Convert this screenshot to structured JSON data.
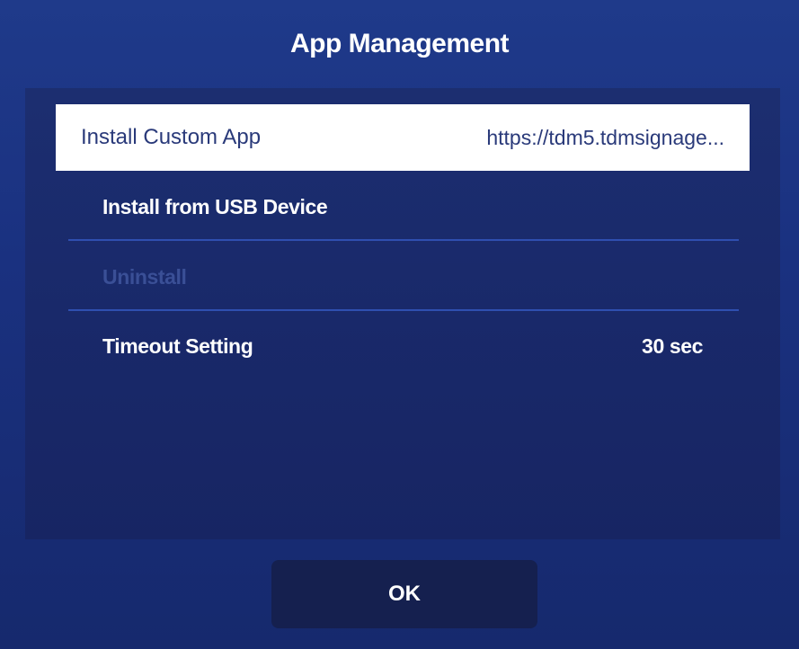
{
  "dialog": {
    "title": "App Management",
    "ok_label": "OK"
  },
  "menu": {
    "items": [
      {
        "label": "Install Custom App",
        "value": "https://tdm5.tdmsignage...",
        "selected": true,
        "enabled": true
      },
      {
        "label": "Install from USB Device",
        "value": "",
        "selected": false,
        "enabled": true
      },
      {
        "label": "Uninstall",
        "value": "",
        "selected": false,
        "enabled": false
      },
      {
        "label": "Timeout Setting",
        "value": "30 sec",
        "selected": false,
        "enabled": true
      }
    ]
  },
  "colors": {
    "background": "#1f3a8a",
    "panel": "#1c2e70",
    "selected_row": "#ffffff",
    "selected_text": "#2a3a7a",
    "disabled_text": "#3a4f96",
    "ok_button": "#15204f"
  }
}
